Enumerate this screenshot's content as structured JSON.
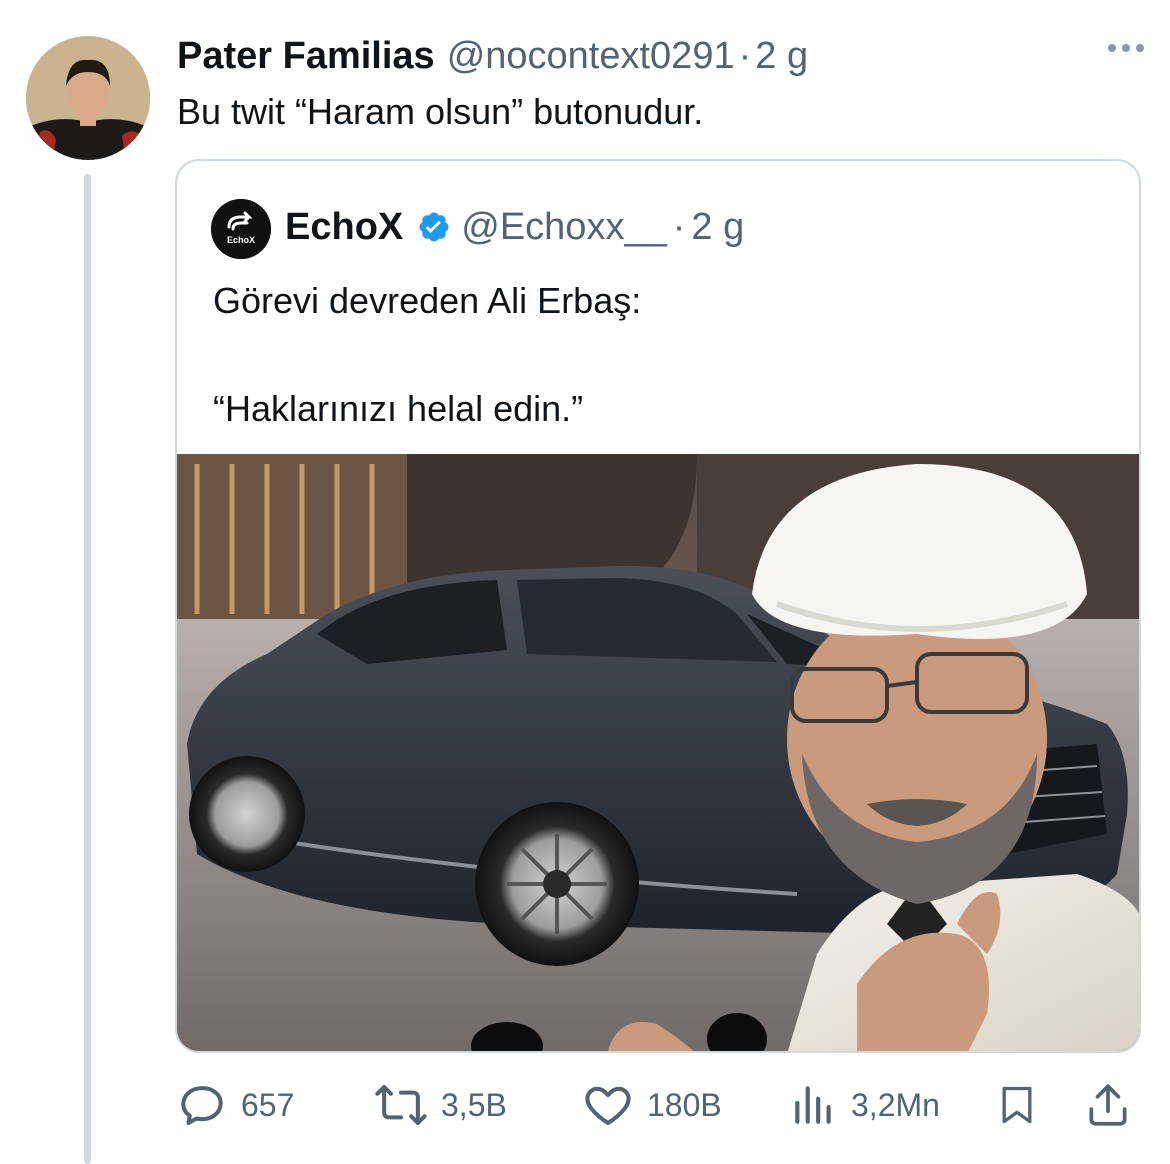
{
  "tweet": {
    "author_name": "Pater Familias",
    "handle": "@nocontext0291",
    "separator": "·",
    "time": "2 g",
    "text": "Bu twit “Haram olsun” butonudur."
  },
  "quote": {
    "author_name": "EchoX",
    "avatar_text": "EchoX",
    "handle": "@Echoxx__",
    "separator": "·",
    "time": "2 g",
    "line1": "Görevi devreden Ali Erbaş:",
    "line2": "“Haklarınızı helal edin.”",
    "verified_color": "#1d9bf0"
  },
  "actions": {
    "replies": "657",
    "reposts": "3,5B",
    "likes": "180B",
    "views": "3,2Mn"
  },
  "icons": {
    "reply": "reply-icon",
    "repost": "repost-icon",
    "like": "heart-icon",
    "views": "views-icon",
    "bookmark": "bookmark-icon",
    "share": "share-icon"
  },
  "colors": {
    "text": "#0f1419",
    "secondary": "#536471",
    "border": "#cfd9de",
    "verified": "#1d9bf0"
  }
}
